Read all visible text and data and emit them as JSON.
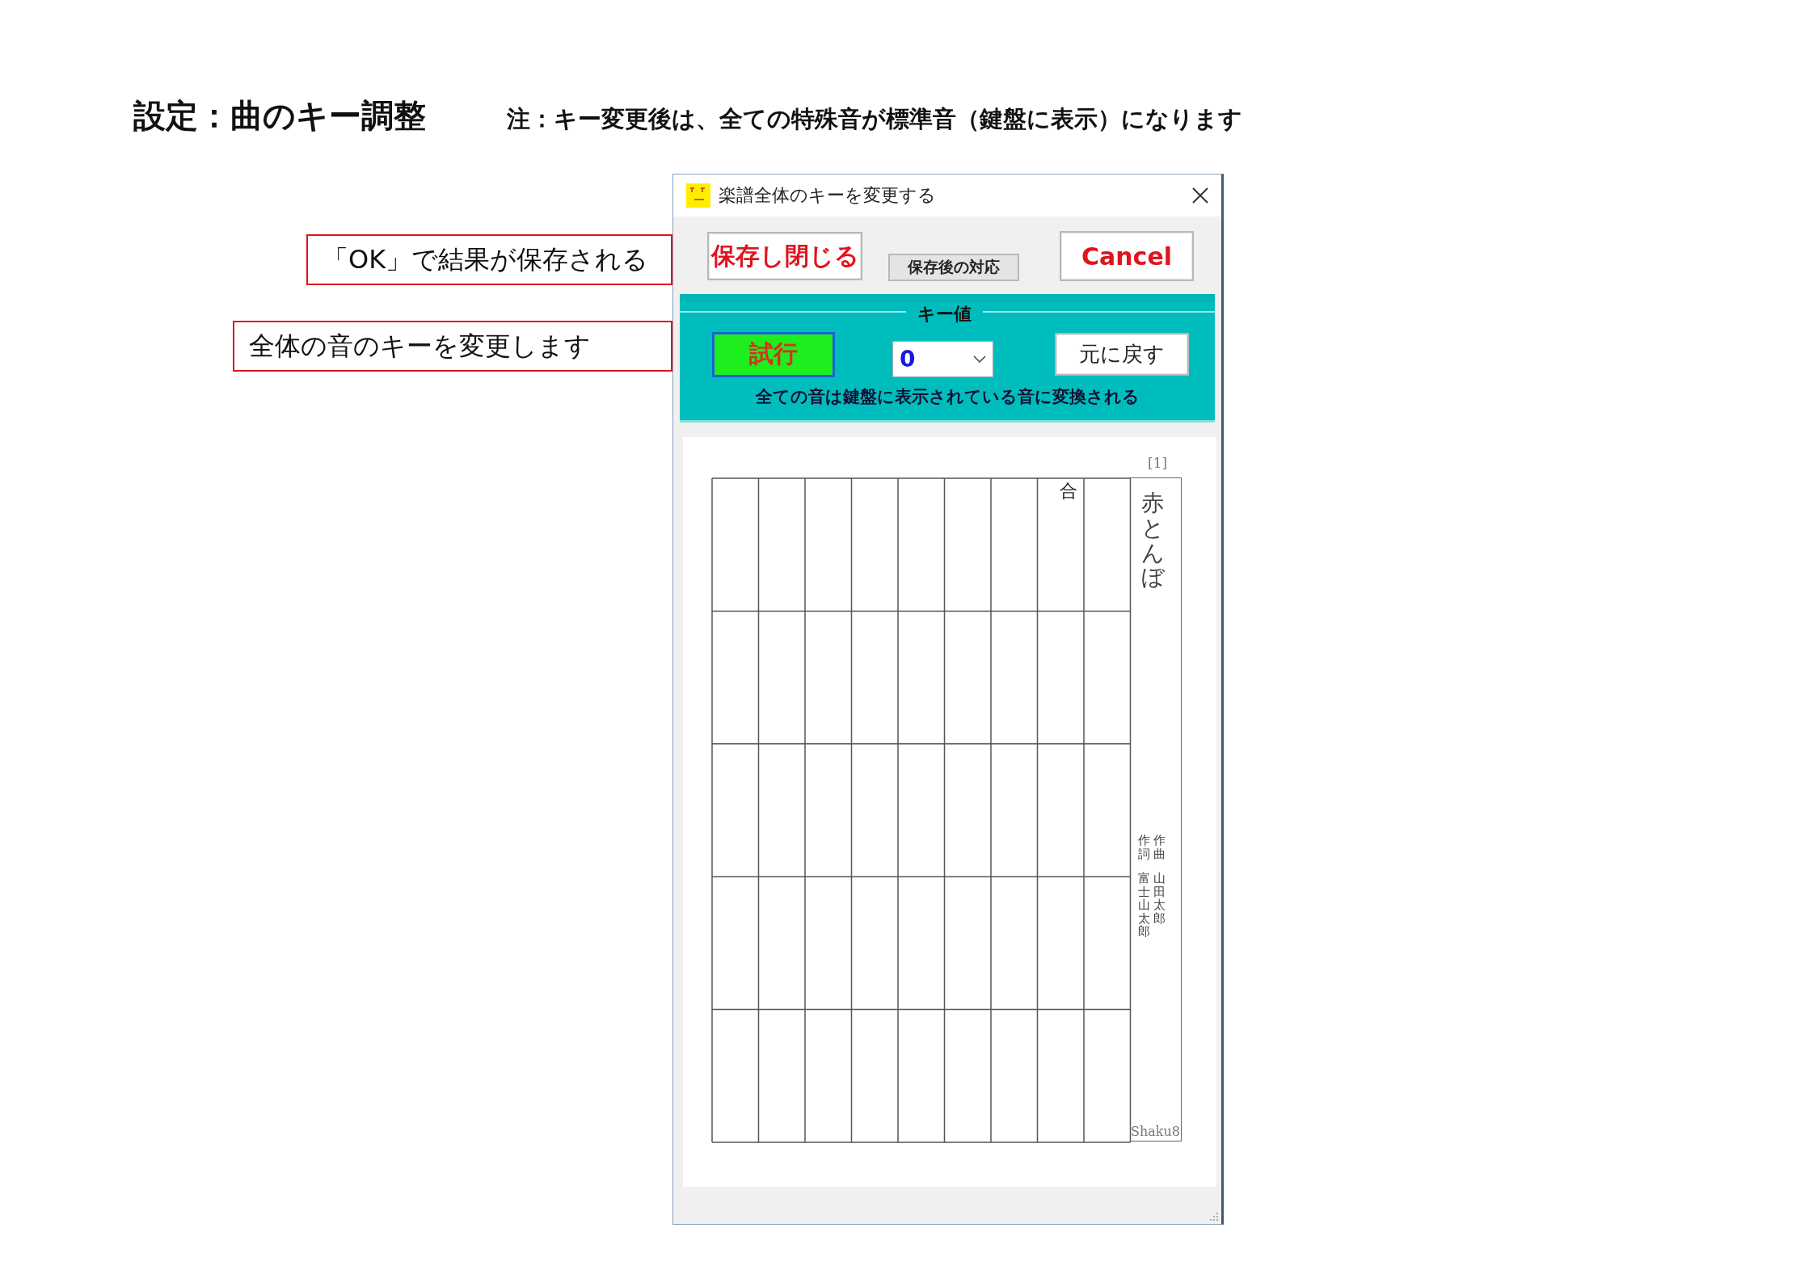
{
  "heading": {
    "title": "設定：曲のキー調整",
    "note": "注：キー変更後は、全ての特殊音が標準音（鍵盤に表示）になります"
  },
  "callouts": [
    "「OK」で結果が保存される",
    "全体の音のキーを変更します"
  ],
  "dialog": {
    "title": "楽譜全体のキーを変更する",
    "save_close_button": "保存し閉じる",
    "after_save_button": "保存後の対応",
    "cancel_button": "Cancel",
    "key_panel": {
      "legend": "キー値",
      "try_button": "試行",
      "key_select": {
        "value": "0"
      },
      "revert_button": "元に戻す",
      "caption": "全ての音は鍵盤に表示されている音に変換される"
    },
    "score": {
      "page_number": "[1]",
      "first_note": "合",
      "title": "赤とんぼ",
      "credits": [
        {
          "role": "作詞",
          "name": "富士山太郎"
        },
        {
          "role": "作曲",
          "name": "山田太郎"
        }
      ],
      "footer": "Shaku8"
    }
  }
}
